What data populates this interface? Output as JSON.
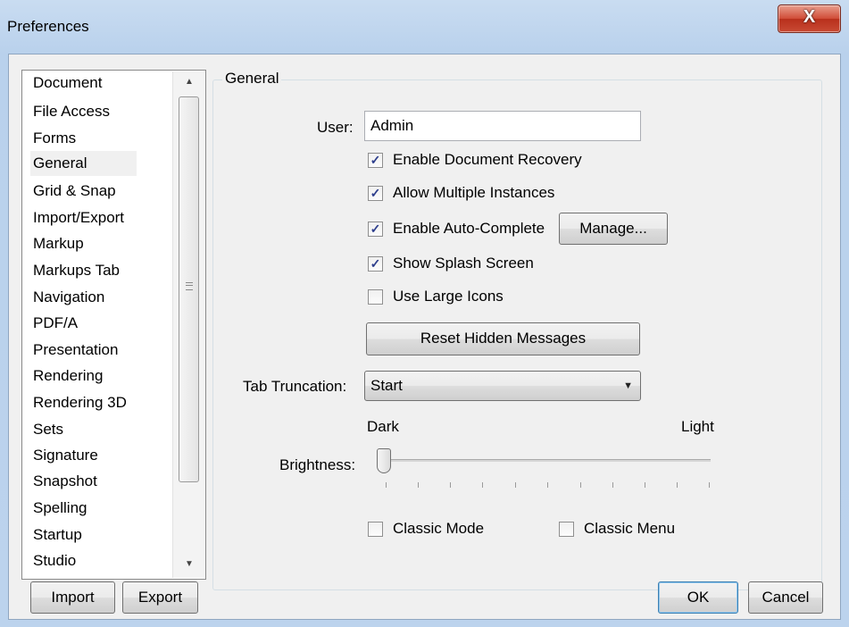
{
  "window": {
    "title": "Preferences",
    "close_label": "X"
  },
  "sidebar": {
    "items": [
      {
        "label": "Document"
      },
      {
        "label": "File Access"
      },
      {
        "label": "Forms"
      },
      {
        "label": "General",
        "selected": true
      },
      {
        "label": "Grid & Snap"
      },
      {
        "label": "Import/Export"
      },
      {
        "label": "Markup"
      },
      {
        "label": "Markups Tab"
      },
      {
        "label": "Navigation"
      },
      {
        "label": "PDF/A"
      },
      {
        "label": "Presentation"
      },
      {
        "label": "Rendering"
      },
      {
        "label": "Rendering 3D"
      },
      {
        "label": "Sets"
      },
      {
        "label": "Signature"
      },
      {
        "label": "Snapshot"
      },
      {
        "label": "Spelling"
      },
      {
        "label": "Startup"
      },
      {
        "label": "Studio"
      }
    ],
    "import_label": "Import",
    "export_label": "Export"
  },
  "general": {
    "group_label": "General",
    "user_label": "User:",
    "user_value": "Admin",
    "options": {
      "document_recovery": {
        "label": "Enable Document Recovery",
        "checked": true
      },
      "multiple_instances": {
        "label": "Allow Multiple Instances",
        "checked": true
      },
      "auto_complete": {
        "label": "Enable Auto-Complete",
        "checked": true
      },
      "splash_screen": {
        "label": "Show Splash Screen",
        "checked": true
      },
      "large_icons": {
        "label": "Use Large Icons",
        "checked": false
      },
      "classic_mode": {
        "label": "Classic Mode",
        "checked": false
      },
      "classic_menu": {
        "label": "Classic Menu",
        "checked": false
      }
    },
    "manage_label": "Manage...",
    "reset_label": "Reset Hidden Messages",
    "tab_truncation_label": "Tab Truncation:",
    "tab_truncation_value": "Start",
    "brightness_label": "Brightness:",
    "brightness_min_label": "Dark",
    "brightness_max_label": "Light",
    "brightness_value": 0,
    "check_glyph": "✓"
  },
  "footer": {
    "ok_label": "OK",
    "cancel_label": "Cancel"
  }
}
